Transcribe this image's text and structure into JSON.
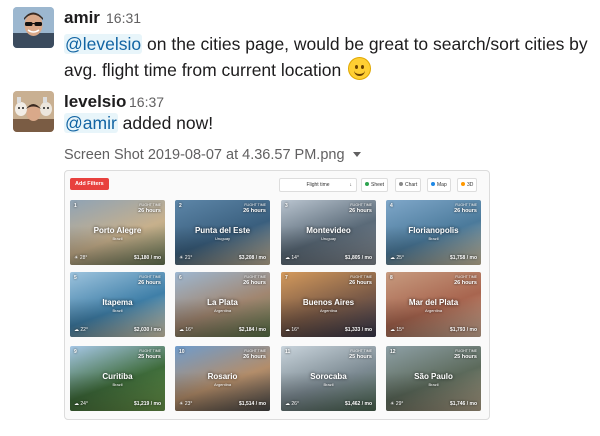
{
  "messages": [
    {
      "sender": "amir",
      "time": "16:31",
      "mention": "@levelsio",
      "text_line1_rest": " on the cities page, would be great to search/sort cities by",
      "text_line2": "avg. flight time from current location",
      "emoji": "slightly-smiling-face"
    },
    {
      "sender": "levelsio",
      "time": "16:37",
      "mention": "@amir",
      "text_rest": " added now!",
      "attachment_name": "Screen Shot 2019-08-07 at 4.36.57 PM.png"
    }
  ],
  "screenshot": {
    "toolbar": {
      "add_filters": "Add Filters",
      "sort_select": "Flight time",
      "sort_caret": "↓",
      "buttons": [
        {
          "label": "Sheet",
          "dot": "#2ea44f"
        },
        {
          "label": "Chart",
          "dot": "#888888"
        },
        {
          "label": "Map",
          "dot": "#1e88e5"
        },
        {
          "label": "3D",
          "dot": "#ff9800"
        }
      ]
    },
    "flight_time_label": "FLIGHT TIME",
    "cards": [
      {
        "rank": "1",
        "city": "Porto Alegre",
        "country": "Brazil",
        "flight_time": "26 hours",
        "weather": "☀ 28°",
        "cost": "$1,180 / mo",
        "colors": [
          "#8fa3b5",
          "#c7b08c",
          "#6b7d5a"
        ]
      },
      {
        "rank": "2",
        "city": "Punta del Este",
        "country": "Uruguay",
        "flight_time": "26 hours",
        "weather": "☀ 21°",
        "cost": "$3,208 / mo",
        "colors": [
          "#5d86a8",
          "#3a5f7e",
          "#c9b89b"
        ]
      },
      {
        "rank": "3",
        "city": "Montevideo",
        "country": "Uruguay",
        "flight_time": "26 hours",
        "weather": "☁ 14°",
        "cost": "$1,805 / mo",
        "colors": [
          "#b9c4cf",
          "#5a6a78",
          "#8b9199"
        ]
      },
      {
        "rank": "4",
        "city": "Florianopolis",
        "country": "Brazil",
        "flight_time": "26 hours",
        "weather": "☁ 25°",
        "cost": "$1,758 / mo",
        "colors": [
          "#7fa7c9",
          "#4b7a9b",
          "#d6c7a6"
        ]
      },
      {
        "rank": "5",
        "city": "Itapema",
        "country": "Brazil",
        "flight_time": "26 hours",
        "weather": "☁ 22°",
        "cost": "$2,030 / mo",
        "colors": [
          "#9dc3dd",
          "#3f7fa8",
          "#e3d7b8"
        ]
      },
      {
        "rank": "6",
        "city": "La Plata",
        "country": "Argentina",
        "flight_time": "26 hours",
        "weather": "☁ 16°",
        "cost": "$2,184 / mo",
        "colors": [
          "#9db7d1",
          "#a18670",
          "#5f7a4d"
        ]
      },
      {
        "rank": "7",
        "city": "Buenos Aires",
        "country": "Argentina",
        "flight_time": "26 hours",
        "weather": "☁ 16°",
        "cost": "$1,333 / mo",
        "colors": [
          "#d49a5c",
          "#7a5a47",
          "#3d3d52"
        ]
      },
      {
        "rank": "8",
        "city": "Mar del Plata",
        "country": "Argentina",
        "flight_time": "26 hours",
        "weather": "☁ 15°",
        "cost": "$1,793 / mo",
        "colors": [
          "#c79b7f",
          "#a8654f",
          "#d6b69e"
        ]
      },
      {
        "rank": "9",
        "city": "Curitiba",
        "country": "Brazil",
        "flight_time": "25 hours",
        "weather": "☁ 24°",
        "cost": "$1,219 / mo",
        "colors": [
          "#a6c7e6",
          "#3e6b3a",
          "#6f9d4d"
        ]
      },
      {
        "rank": "10",
        "city": "Rosario",
        "country": "Argentina",
        "flight_time": "26 hours",
        "weather": "☀ 23°",
        "cost": "$1,514 / mo",
        "colors": [
          "#6f9ccc",
          "#b38d6a",
          "#4a4a4a"
        ]
      },
      {
        "rank": "11",
        "city": "Sorocaba",
        "country": "Brazil",
        "flight_time": "25 hours",
        "weather": "☁ 26°",
        "cost": "$1,462 / mo",
        "colors": [
          "#c9d4dc",
          "#7c8a92",
          "#4f6b55"
        ]
      },
      {
        "rank": "12",
        "city": "São Paulo",
        "country": "Brazil",
        "flight_time": "25 hours",
        "weather": "☀ 29°",
        "cost": "$1,746 / mo",
        "colors": [
          "#8ea0a6",
          "#5c6a5b",
          "#b5a68c"
        ]
      }
    ]
  }
}
